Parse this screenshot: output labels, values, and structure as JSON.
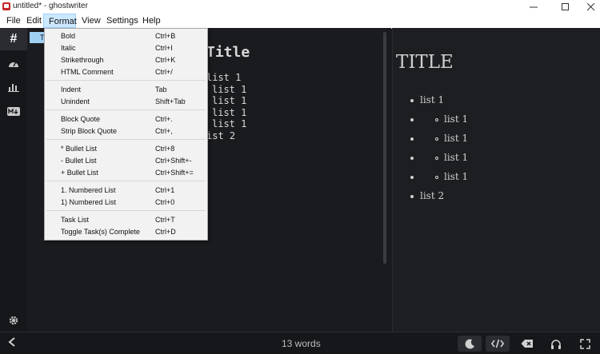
{
  "window": {
    "title": "untitled* - ghostwriter"
  },
  "menubar": {
    "items": [
      "File",
      "Edit",
      "Format",
      "View",
      "Settings",
      "Help"
    ]
  },
  "editor": {
    "peek": "T",
    "heading": "Title",
    "lines": [
      "list 1",
      "list 1",
      "list 1",
      "list 1",
      "list 1",
      "ist 2"
    ]
  },
  "preview": {
    "title": "TITLE",
    "items": [
      "list 1",
      "list 1",
      "list 1",
      "list 1",
      "list 1",
      "list 2"
    ]
  },
  "format_menu": {
    "items": [
      {
        "label": "Bold",
        "shortcut": "Ctrl+B"
      },
      {
        "label": "Italic",
        "shortcut": "Ctrl+I"
      },
      {
        "label": "Strikethrough",
        "shortcut": "Ctrl+K"
      },
      {
        "label": "HTML Comment",
        "shortcut": "Ctrl+/"
      },
      {
        "label": "Indent",
        "shortcut": "Tab"
      },
      {
        "label": "Unindent",
        "shortcut": "Shift+Tab"
      },
      {
        "label": "Block Quote",
        "shortcut": "Ctrl+."
      },
      {
        "label": "Strip Block Quote",
        "shortcut": "Ctrl+,"
      },
      {
        "label": "* Bullet List",
        "shortcut": "Ctrl+8"
      },
      {
        "label": "- Bullet List",
        "shortcut": "Ctrl+Shift+-"
      },
      {
        "label": "+ Bullet List",
        "shortcut": "Ctrl+Shift+="
      },
      {
        "label": "1. Numbered List",
        "shortcut": "Ctrl+1"
      },
      {
        "label": "1) Numbered List",
        "shortcut": "Ctrl+0"
      },
      {
        "label": "Task List",
        "shortcut": "Ctrl+T"
      },
      {
        "label": "Toggle Task(s) Complete",
        "shortcut": "Ctrl+D"
      }
    ]
  },
  "status": {
    "word_count": "13 words"
  },
  "icons": {
    "sidebar": [
      "hash-icon",
      "dashboard-icon",
      "statistics-icon",
      "markdown-icon",
      "settings-gear-icon"
    ],
    "statusbar": [
      "chevron-left-icon",
      "moon-icon",
      "code-icon",
      "backspace-icon",
      "headphones-icon",
      "fullscreen-icon"
    ]
  },
  "colors": {
    "menu_active": "#cce8ff",
    "background": "#1a1b1e",
    "brand": "#c62828"
  }
}
